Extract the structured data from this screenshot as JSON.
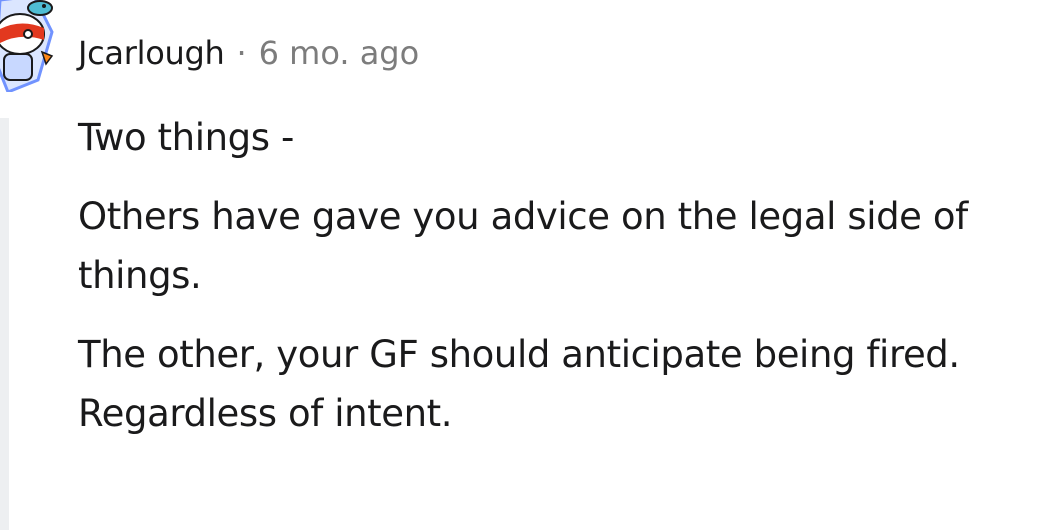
{
  "comment": {
    "author": "Jcarlough",
    "separator": "·",
    "time": "6 mo. ago",
    "paragraphs": [
      "Two things -",
      "Others have gave you advice on the legal side of things.",
      "The other, your GF should anticipate being fired. Regardless of intent."
    ]
  },
  "colors": {
    "text": "#1a1a1b",
    "meta": "#7c7c7c",
    "thread_line": "#edeff1",
    "avatar_blue": "#7193ff",
    "avatar_red": "#e2381f",
    "avatar_teal": "#4fbdd4"
  },
  "icons": {
    "avatar": "snoo-avatar-icon"
  }
}
